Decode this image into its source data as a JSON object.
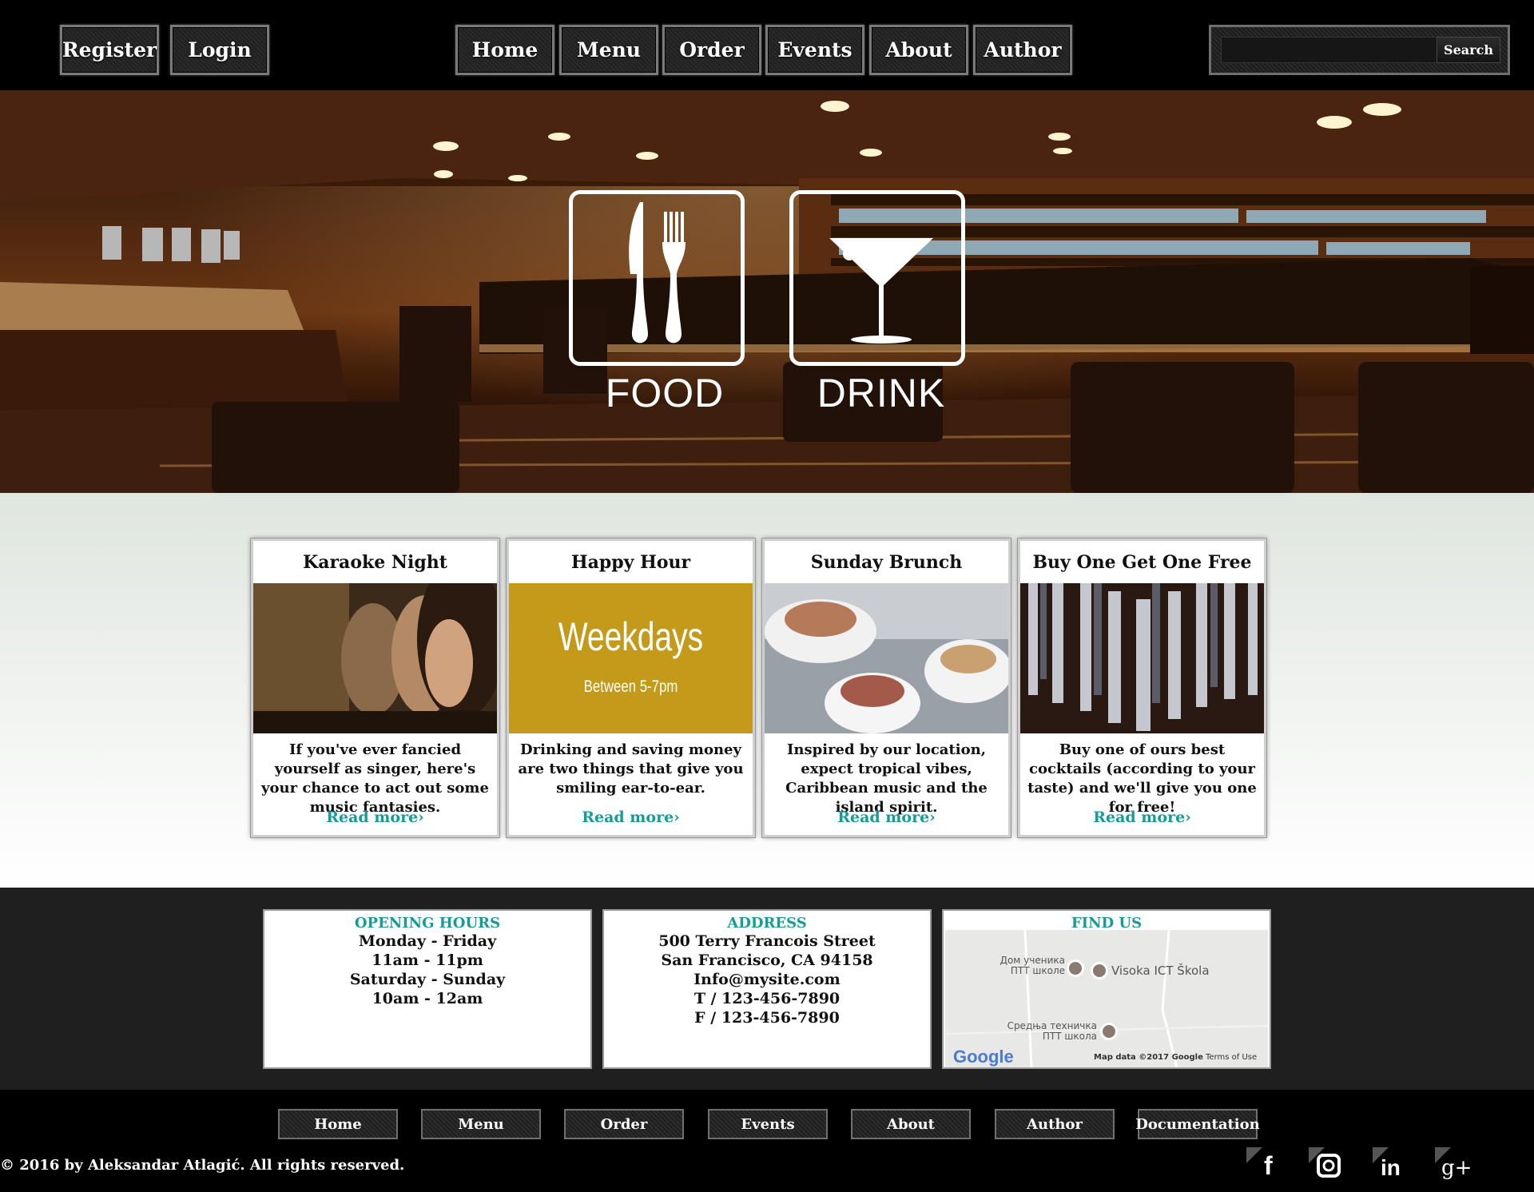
{
  "header": {
    "account": [
      {
        "label": "Register"
      },
      {
        "label": "Login"
      }
    ],
    "nav": [
      {
        "label": "Home"
      },
      {
        "label": "Menu"
      },
      {
        "label": "Order"
      },
      {
        "label": "Events"
      },
      {
        "label": "About"
      },
      {
        "label": "Author"
      }
    ],
    "search": {
      "value": "",
      "button_label": "Search"
    }
  },
  "hero": {
    "tiles": [
      {
        "label": "FOOD",
        "icon": "cutlery-icon"
      },
      {
        "label": "DRINK",
        "icon": "cocktail-glass-icon"
      }
    ]
  },
  "events": [
    {
      "title": "Karaoke Night",
      "text": "If you've ever fancied yourself as singer, here's your chance to act out some music fantasies.",
      "link": "Read more›"
    },
    {
      "title": "Happy Hour",
      "text": "Drinking and saving money are two things that give you smiling ear-to-ear.",
      "link": "Read more›",
      "image_title": "Weekdays",
      "image_subtitle": "Between 5-7pm"
    },
    {
      "title": "Sunday Brunch",
      "text": "Inspired by our location, expect tropical vibes, Caribbean music and the island spirit.",
      "link": "Read more›"
    },
    {
      "title": "Buy One Get One Free",
      "text": "Buy one of ours best cocktails (according to your taste) and we'll give you one for free!",
      "link": "Read more›"
    }
  ],
  "info": {
    "hours": {
      "title": "OPENING HOURS",
      "lines": [
        "Monday - Friday",
        "11am - 11pm",
        "Saturday - Sunday",
        "10am - 12am"
      ]
    },
    "address": {
      "title": "ADDRESS",
      "lines": [
        "500 Terry Francois Street",
        "San Francisco, CA 94158",
        "Info@mysite.com",
        "T / 123-456-7890",
        "F / 123-456-7890"
      ]
    },
    "map": {
      "title": "FIND US",
      "places": [
        "Дом ученика ПТТ школе",
        "Visoka ICT Škola",
        "Средња техничка ПТТ школа"
      ],
      "logo": "Google",
      "attribution": "Map data ©2017 Google",
      "terms": "Terms of Use"
    }
  },
  "footer": {
    "nav": [
      {
        "label": "Home"
      },
      {
        "label": "Menu"
      },
      {
        "label": "Order"
      },
      {
        "label": "Events"
      },
      {
        "label": "About"
      },
      {
        "label": "Author"
      },
      {
        "label": "Documentation"
      }
    ],
    "copyright": "© 2016 by Aleksandar Atlagić. All rights reserved.",
    "social": [
      {
        "icon": "facebook-icon",
        "glyph": "f"
      },
      {
        "icon": "instagram-icon",
        "glyph": ""
      },
      {
        "icon": "linkedin-icon",
        "glyph": "in"
      },
      {
        "icon": "google-plus-icon",
        "glyph": "g+"
      }
    ]
  },
  "colors": {
    "accent": "#1a9a96",
    "topbar": "#000000",
    "happy_hour_bg": "#c39a1a"
  }
}
